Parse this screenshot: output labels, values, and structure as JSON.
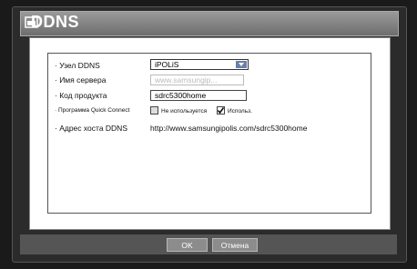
{
  "window": {
    "title": "DDNS"
  },
  "form": {
    "ddns_node_label": "· Узел DDNS",
    "ddns_node_value": "iPOLiS",
    "server_name_label": "· Имя сервера",
    "server_name_placeholder": "www.samsungip...",
    "product_code_label": "· Код продукта",
    "product_code_value": "sdrc5300home",
    "quick_connect_label": "· Программа Quick Connect",
    "option_not_used": "Не используется",
    "option_use": "Использ.",
    "host_address_label": "· Адрес хоста DDNS",
    "host_address_value": "http://www.samsungipolis.com/sdrc5300home"
  },
  "buttons": {
    "ok": "OK",
    "cancel": "Отмена"
  }
}
